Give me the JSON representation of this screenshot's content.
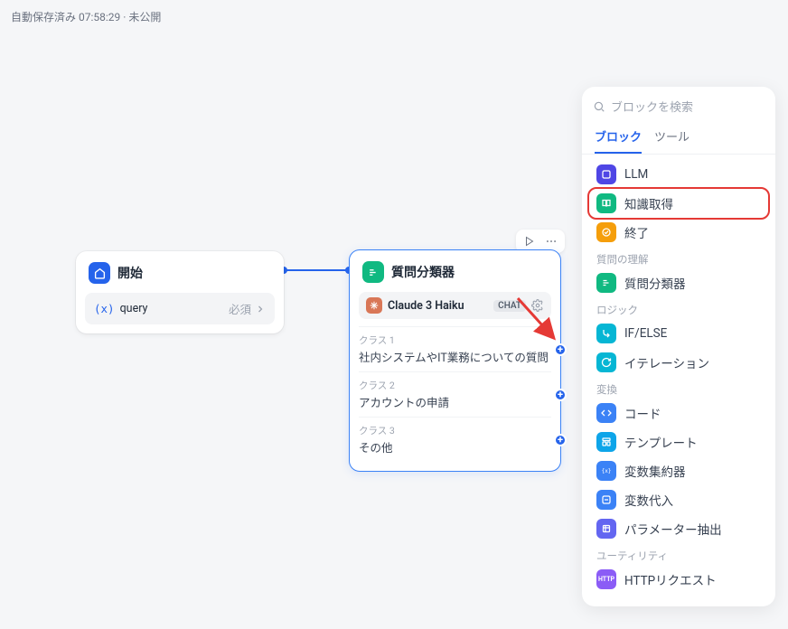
{
  "status": {
    "autosave": "自動保存済み 07:58:29",
    "sep": "·",
    "publish": "未公開"
  },
  "start_node": {
    "title": "開始",
    "var_symbol": "(x)",
    "var_name": "query",
    "required": "必須"
  },
  "classifier_node": {
    "title": "質問分類器",
    "model_name": "Claude 3 Haiku",
    "chat_badge": "CHAT",
    "classes": [
      {
        "label": "クラス 1",
        "text": "社内システムやIT業務についての質問"
      },
      {
        "label": "クラス 2",
        "text": "アカウントの申請"
      },
      {
        "label": "クラス 3",
        "text": "その他"
      }
    ]
  },
  "panel": {
    "search_placeholder": "ブロックを検索",
    "tabs": {
      "blocks": "ブロック",
      "tools": "ツール"
    },
    "items": {
      "llm": "LLM",
      "knowledge": "知識取得",
      "end": "終了",
      "section_qa": "質問の理解",
      "classifier": "質問分類器",
      "section_logic": "ロジック",
      "ifelse": "IF/ELSE",
      "iteration": "イテレーション",
      "section_transform": "変換",
      "code": "コード",
      "template": "テンプレート",
      "aggregator": "変数集約器",
      "assign": "変数代入",
      "param": "パラメーター抽出",
      "section_util": "ユーティリティ",
      "http": "HTTPリクエスト"
    }
  }
}
